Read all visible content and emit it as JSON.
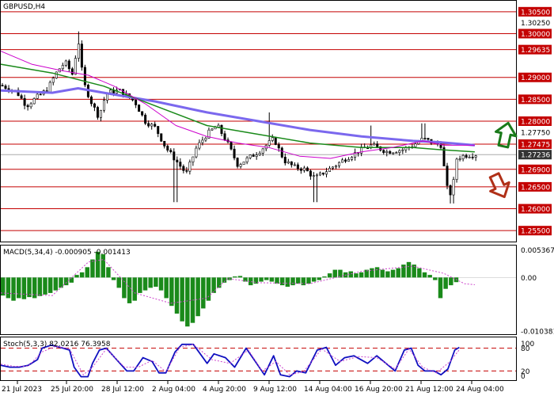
{
  "chart_data": [
    {
      "type": "candlestick",
      "title": "GBPUSD,H4",
      "ylim": [
        1.2525,
        1.3075
      ],
      "y_ticks": [
        "1.30500",
        "1.30250",
        "1.30000",
        "1.29635",
        "1.29000",
        "1.28500",
        "1.28000",
        "1.27750",
        "1.27475",
        "1.27236",
        "1.26900",
        "1.26500",
        "1.26000",
        "1.25500"
      ],
      "levels": [
        {
          "label": "1.30500",
          "value": 1.305
        },
        {
          "label": "1.30000",
          "value": 1.3
        },
        {
          "label": "1.29635",
          "value": 1.29635
        },
        {
          "label": "1.29000",
          "value": 1.29
        },
        {
          "label": "1.28500",
          "value": 1.285
        },
        {
          "label": "1.28000",
          "value": 1.28
        },
        {
          "label": "1.27475",
          "value": 1.27475
        },
        {
          "label": "1.26900",
          "value": 1.269
        },
        {
          "label": "1.26500",
          "value": 1.265
        },
        {
          "label": "1.26000",
          "value": 1.26
        },
        {
          "label": "1.25500",
          "value": 1.255
        }
      ],
      "current_price": {
        "label": "1.27236",
        "value": 1.27236
      },
      "x_labels": [
        "21 Jul 2023",
        "25 Jul 20:00",
        "28 Jul 12:00",
        "2 Aug 04:00",
        "4 Aug 20:00",
        "9 Aug 12:00",
        "14 Aug 04:00",
        "16 Aug 20:00",
        "21 Aug 12:00",
        "24 Aug 04:00"
      ],
      "close_path": [
        [
          0,
          1.2882
        ],
        [
          0.03,
          1.2868
        ],
        [
          0.05,
          1.2835
        ],
        [
          0.07,
          1.2855
        ],
        [
          0.09,
          1.2872
        ],
        [
          0.11,
          1.2915
        ],
        [
          0.125,
          1.2935
        ],
        [
          0.14,
          1.2905
        ],
        [
          0.15,
          1.299
        ],
        [
          0.16,
          1.289
        ],
        [
          0.175,
          1.2845
        ],
        [
          0.19,
          1.281
        ],
        [
          0.205,
          1.2865
        ],
        [
          0.23,
          1.287
        ],
        [
          0.26,
          1.2845
        ],
        [
          0.28,
          1.28
        ],
        [
          0.3,
          1.2785
        ],
        [
          0.32,
          1.274
        ],
        [
          0.34,
          1.271
        ],
        [
          0.36,
          1.268
        ],
        [
          0.38,
          1.274
        ],
        [
          0.4,
          1.277
        ],
        [
          0.42,
          1.279
        ],
        [
          0.44,
          1.275
        ],
        [
          0.46,
          1.27
        ],
        [
          0.48,
          1.2715
        ],
        [
          0.5,
          1.273
        ],
        [
          0.53,
          1.276
        ],
        [
          0.55,
          1.271
        ],
        [
          0.57,
          1.2695
        ],
        [
          0.59,
          1.269
        ],
        [
          0.61,
          1.267
        ],
        [
          0.63,
          1.2685
        ],
        [
          0.65,
          1.27
        ],
        [
          0.67,
          1.2715
        ],
        [
          0.7,
          1.2735
        ],
        [
          0.72,
          1.2745
        ],
        [
          0.75,
          1.273
        ],
        [
          0.78,
          1.2735
        ],
        [
          0.8,
          1.2745
        ],
        [
          0.82,
          1.276
        ],
        [
          0.84,
          1.275
        ],
        [
          0.855,
          1.2745
        ],
        [
          0.865,
          1.265
        ],
        [
          0.875,
          1.263
        ],
        [
          0.885,
          1.2715
        ],
        [
          0.9,
          1.2722
        ],
        [
          0.92,
          1.2724
        ]
      ],
      "high_spikes": [
        [
          0.15,
          1.3005
        ],
        [
          0.52,
          1.282
        ],
        [
          0.72,
          1.279
        ],
        [
          0.82,
          1.2795
        ]
      ],
      "low_spikes": [
        [
          0.34,
          1.2615
        ],
        [
          0.61,
          1.2615
        ],
        [
          0.875,
          1.2612
        ]
      ],
      "ma_green": [
        [
          0,
          1.293
        ],
        [
          0.1,
          1.291
        ],
        [
          0.2,
          1.288
        ],
        [
          0.3,
          1.2835
        ],
        [
          0.4,
          1.279
        ],
        [
          0.5,
          1.277
        ],
        [
          0.6,
          1.275
        ],
        [
          0.7,
          1.274
        ],
        [
          0.8,
          1.274
        ],
        [
          0.85,
          1.2735
        ],
        [
          0.92,
          1.273
        ]
      ],
      "ma_blue": [
        [
          0,
          1.287
        ],
        [
          0.1,
          1.2865
        ],
        [
          0.15,
          1.2875
        ],
        [
          0.2,
          1.2865
        ],
        [
          0.3,
          1.2845
        ],
        [
          0.4,
          1.282
        ],
        [
          0.5,
          1.28
        ],
        [
          0.6,
          1.278
        ],
        [
          0.7,
          1.2765
        ],
        [
          0.8,
          1.2755
        ],
        [
          0.85,
          1.2752
        ],
        [
          0.92,
          1.2745
        ]
      ],
      "ma_magenta": [
        [
          0,
          1.296
        ],
        [
          0.06,
          1.293
        ],
        [
          0.12,
          1.2915
        ],
        [
          0.17,
          1.2905
        ],
        [
          0.22,
          1.288
        ],
        [
          0.28,
          1.284
        ],
        [
          0.34,
          1.279
        ],
        [
          0.4,
          1.2765
        ],
        [
          0.46,
          1.275
        ],
        [
          0.52,
          1.274
        ],
        [
          0.58,
          1.272
        ],
        [
          0.64,
          1.2715
        ],
        [
          0.7,
          1.273
        ],
        [
          0.76,
          1.274
        ],
        [
          0.82,
          1.2755
        ],
        [
          0.86,
          1.2745
        ],
        [
          0.92,
          1.2745
        ]
      ]
    },
    {
      "type": "bar",
      "title": "MACD(5,34,4) -0.000905 -0.001413",
      "ylim": [
        -0.011,
        0.0062
      ],
      "y_ticks": [
        {
          "label": "0.005367",
          "value": 0.005367
        },
        {
          "label": "0.00",
          "value": 0.0
        },
        {
          "label": "-0.010381",
          "value": -0.010381
        }
      ],
      "histogram": [
        -0.0035,
        -0.004,
        -0.0045,
        -0.004,
        -0.0042,
        -0.0038,
        -0.004,
        -0.0036,
        -0.0033,
        -0.003,
        -0.0025,
        -0.002,
        -0.0015,
        -0.001,
        0.0005,
        0.001,
        0.002,
        0.0035,
        0.005,
        0.0045,
        0.002,
        -0.0005,
        -0.002,
        -0.004,
        -0.005,
        -0.0045,
        -0.003,
        -0.0025,
        -0.002,
        -0.0018,
        -0.0025,
        -0.004,
        -0.0055,
        -0.007,
        -0.0085,
        -0.0095,
        -0.0088,
        -0.0075,
        -0.006,
        -0.0045,
        -0.003,
        -0.002,
        -0.001,
        -0.0005,
        0.0002,
        0.0003,
        -0.0008,
        -0.0015,
        -0.0012,
        -0.0008,
        -0.0005,
        -0.0008,
        -0.0012,
        -0.0015,
        -0.0018,
        -0.0015,
        -0.0012,
        -0.0015,
        -0.0012,
        -0.0008,
        -0.0005,
        0.0002,
        0.0008,
        0.0015,
        0.0015,
        0.001,
        0.0012,
        0.0008,
        0.001,
        0.0015,
        0.0018,
        0.002,
        0.0015,
        0.0012,
        0.0015,
        0.0018,
        0.0025,
        0.003,
        0.0025,
        0.0018,
        0.001,
        0.0005,
        -0.0005,
        -0.004,
        -0.0022,
        -0.0015,
        -0.0009
      ],
      "signal": [
        [
          0,
          -0.003
        ],
        [
          0.1,
          -0.0035
        ],
        [
          0.17,
          0.003
        ],
        [
          0.2,
          0.0035
        ],
        [
          0.26,
          -0.003
        ],
        [
          0.33,
          -0.005
        ],
        [
          0.4,
          -0.004
        ],
        [
          0.44,
          -0.0002
        ],
        [
          0.5,
          -0.001
        ],
        [
          0.6,
          -0.0012
        ],
        [
          0.7,
          0.0012
        ],
        [
          0.8,
          0.0022
        ],
        [
          0.86,
          0.0008
        ],
        [
          0.9,
          -0.0012
        ],
        [
          0.92,
          -0.0014
        ]
      ]
    },
    {
      "type": "line",
      "title": "Stoch(5,3,3) 82.0216 76.3958",
      "ylim": [
        0,
        100
      ],
      "y_ticks": [
        {
          "label": "100",
          "value": 100
        },
        {
          "label": "80",
          "value": 80
        },
        {
          "label": "20",
          "value": 20
        },
        {
          "label": "0",
          "value": 0
        }
      ],
      "levels": [
        80,
        20
      ],
      "main": [
        [
          0,
          35
        ],
        [
          0.02,
          30
        ],
        [
          0.04,
          30
        ],
        [
          0.06,
          35
        ],
        [
          0.08,
          50
        ],
        [
          0.09,
          80
        ],
        [
          0.11,
          88
        ],
        [
          0.13,
          82
        ],
        [
          0.15,
          75
        ],
        [
          0.16,
          30
        ],
        [
          0.175,
          5
        ],
        [
          0.19,
          5
        ],
        [
          0.2,
          40
        ],
        [
          0.215,
          75
        ],
        [
          0.23,
          80
        ],
        [
          0.26,
          40
        ],
        [
          0.275,
          20
        ],
        [
          0.29,
          20
        ],
        [
          0.31,
          55
        ],
        [
          0.33,
          45
        ],
        [
          0.345,
          15
        ],
        [
          0.36,
          15
        ],
        [
          0.38,
          70
        ],
        [
          0.395,
          90
        ],
        [
          0.42,
          90
        ],
        [
          0.45,
          40
        ],
        [
          0.465,
          65
        ],
        [
          0.49,
          55
        ],
        [
          0.51,
          30
        ],
        [
          0.535,
          80
        ],
        [
          0.555,
          45
        ],
        [
          0.575,
          10
        ],
        [
          0.595,
          60
        ],
        [
          0.61,
          10
        ],
        [
          0.63,
          5
        ],
        [
          0.645,
          20
        ],
        [
          0.665,
          15
        ],
        [
          0.69,
          75
        ],
        [
          0.71,
          82
        ],
        [
          0.73,
          35
        ],
        [
          0.75,
          55
        ],
        [
          0.77,
          60
        ],
        [
          0.8,
          40
        ],
        [
          0.82,
          60
        ],
        [
          0.84,
          40
        ],
        [
          0.86,
          20
        ],
        [
          0.88,
          75
        ],
        [
          0.895,
          80
        ],
        [
          0.91,
          35
        ],
        [
          0.925,
          20
        ],
        [
          0.945,
          20
        ],
        [
          0.96,
          10
        ],
        [
          0.975,
          25
        ],
        [
          0.99,
          75
        ],
        [
          1.0,
          82
        ]
      ],
      "signal": [
        [
          0,
          38
        ],
        [
          0.03,
          32
        ],
        [
          0.06,
          33
        ],
        [
          0.09,
          70
        ],
        [
          0.12,
          85
        ],
        [
          0.15,
          78
        ],
        [
          0.18,
          10
        ],
        [
          0.2,
          30
        ],
        [
          0.23,
          78
        ],
        [
          0.27,
          30
        ],
        [
          0.3,
          30
        ],
        [
          0.33,
          48
        ],
        [
          0.36,
          18
        ],
        [
          0.39,
          82
        ],
        [
          0.42,
          90
        ],
        [
          0.46,
          50
        ],
        [
          0.5,
          40
        ],
        [
          0.54,
          75
        ],
        [
          0.57,
          20
        ],
        [
          0.6,
          45
        ],
        [
          0.63,
          10
        ],
        [
          0.66,
          18
        ],
        [
          0.7,
          78
        ],
        [
          0.74,
          45
        ],
        [
          0.78,
          58
        ],
        [
          0.82,
          55
        ],
        [
          0.86,
          25
        ],
        [
          0.89,
          78
        ],
        [
          0.92,
          30
        ],
        [
          0.95,
          15
        ],
        [
          0.98,
          45
        ],
        [
          1.0,
          76
        ]
      ]
    }
  ],
  "colors": {
    "level_line": "#c40000",
    "level_label_bg": "#c40000",
    "price_label_bg": "#333333",
    "candle": "#000000",
    "ma_green": "#1a8a1a",
    "ma_blue": "#7b68ee",
    "ma_magenta": "#cc00cc",
    "macd_histogram": "#1a8a1a",
    "macd_signal": "#cc44cc",
    "stoch_main": "#1010c0",
    "stoch_signal": "#cc44cc",
    "stoch_levels": "#c40000",
    "arrow_up": "#1a7a1a",
    "arrow_down": "#b03018"
  },
  "icons": {
    "arrow_up": "green-arrow-up-icon",
    "arrow_down": "red-arrow-down-icon"
  }
}
